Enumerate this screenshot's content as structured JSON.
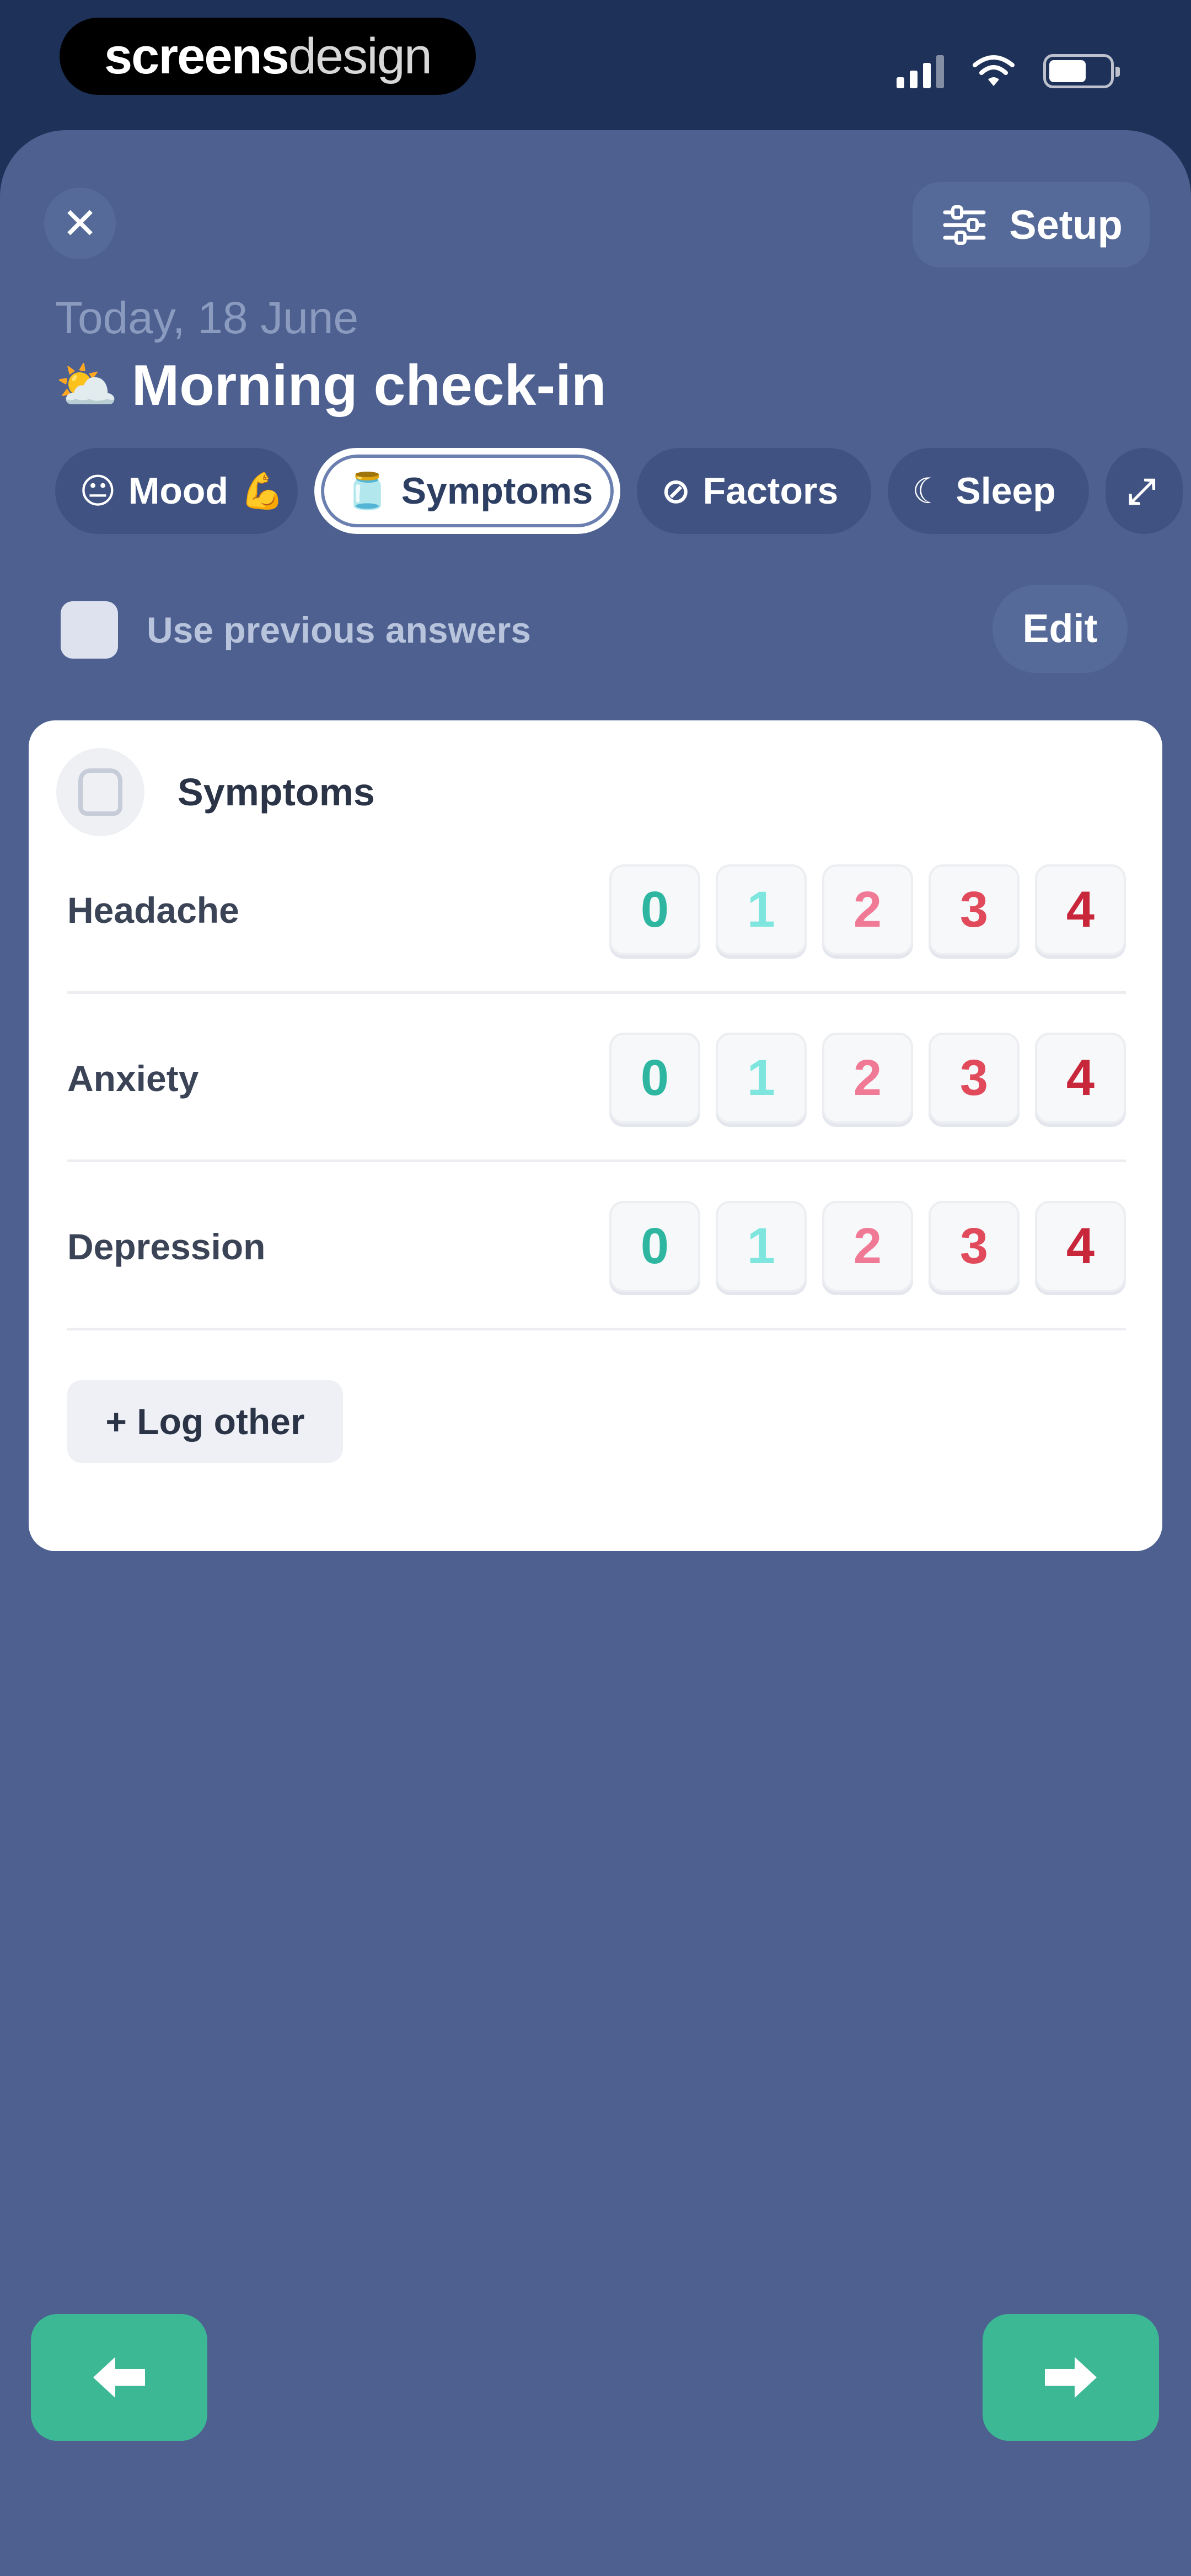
{
  "status_bar": {
    "brand_part1": "screens",
    "brand_part2": "design"
  },
  "header": {
    "close_label": "✕",
    "setup_label": "Setup",
    "date": "Today, 18 June",
    "weather_icon": "⛅",
    "title": "Morning check-in"
  },
  "tabs": [
    {
      "label": "Mood",
      "icon": "😐",
      "extra": "💪",
      "active": false
    },
    {
      "label": "Symptoms",
      "icon": "🫙",
      "active": true
    },
    {
      "label": "Factors",
      "icon": "⊘",
      "active": false
    },
    {
      "label": "Sleep",
      "icon": "☾",
      "active": false
    },
    {
      "label": "",
      "icon": "⤢",
      "active": false
    }
  ],
  "previous_answers": {
    "label": "Use previous answers",
    "checked": false,
    "edit_label": "Edit"
  },
  "card": {
    "title": "Symptoms",
    "scale": [
      "0",
      "1",
      "2",
      "3",
      "4"
    ],
    "rows": [
      {
        "name": "Headache"
      },
      {
        "name": "Anxiety"
      },
      {
        "name": "Depression"
      }
    ],
    "log_other_label": "+ Log other"
  },
  "colors": {
    "background": "#4d6090",
    "accent": "#3cb895",
    "scale_colors": [
      "#2fb6a0",
      "#7fe6df",
      "#f07a96",
      "#e04a5a",
      "#c8263a"
    ]
  },
  "icons": {
    "back": "arrow-left-icon",
    "next": "arrow-right-icon"
  }
}
